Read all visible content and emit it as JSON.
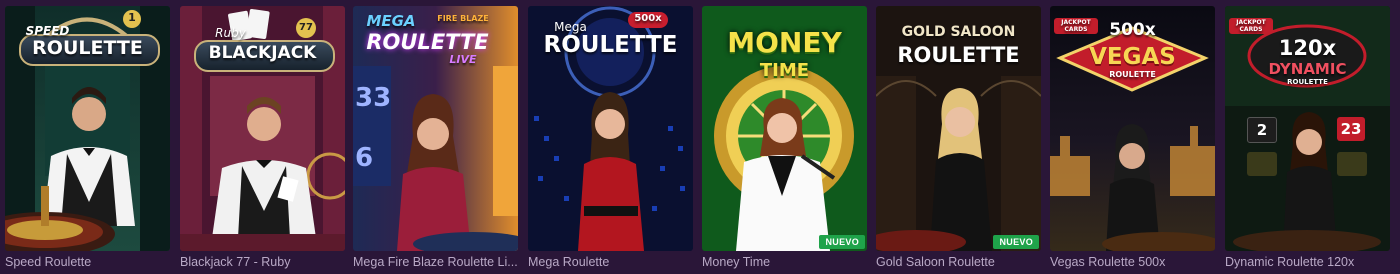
{
  "games": [
    {
      "title": "Speed Roulette",
      "logo_top": "SPEED",
      "logo_main": "ROULETTE",
      "chip": "1",
      "badge": ""
    },
    {
      "title": "Blackjack 77 - Ruby",
      "logo_top": "Ruby",
      "logo_main": "BLACKJACK",
      "chip": "77",
      "badge": ""
    },
    {
      "title": "Mega Fire Blaze Roulette Li...",
      "logo_top": "MEGA",
      "logo_fire": "FIRE BLAZE",
      "logo_main": "ROULETTE",
      "logo_sub": "LIVE",
      "badge": ""
    },
    {
      "title": "Mega Roulette",
      "logo_top": "Mega",
      "logo_main": "ROULETTE",
      "multiplier": "500x",
      "badge": ""
    },
    {
      "title": "Money Time",
      "logo_top": "MONEY",
      "logo_main": "TIME",
      "badge": "NUEVO"
    },
    {
      "title": "Gold Saloon Roulette",
      "logo_top": "GOLD SALOON",
      "logo_main": "ROULETTE",
      "badge": "NUEVO"
    },
    {
      "title": "Vegas Roulette 500x",
      "logo_top": "500x",
      "logo_main": "VEGAS",
      "logo_sub": "ROULETTE",
      "jackpot": "JACKPOT CARDS",
      "badge": ""
    },
    {
      "title": "Dynamic Roulette 120x",
      "logo_top": "120x",
      "logo_main": "DYNAMIC",
      "logo_sub": "ROULETTE",
      "jackpot": "JACKPOT CARDS",
      "numbers": [
        "2",
        "23"
      ],
      "badge": ""
    }
  ]
}
